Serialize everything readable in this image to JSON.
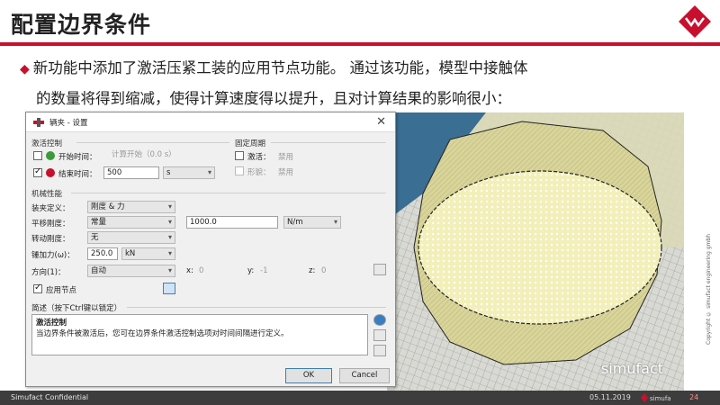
{
  "slide": {
    "title": "配置边界条件",
    "bullet_line1": "新功能中添加了激活压紧工装的应用节点功能。 通过该功能，模型中接触体",
    "bullet_line2": "的数量将得到缩减，使得计算速度得以提升，且对计算结果的影响很小：",
    "bullet_glyph": "◆"
  },
  "colors": {
    "accent": "#c8102e",
    "footer": "#3d3d3d",
    "mesh": "#f2efb8"
  },
  "dialog": {
    "title": "辆夹 - 设置",
    "close_glyph": "✕",
    "activation_group": "激活控制",
    "start_time_label": "开始时间：",
    "start_time_value": "计算开始（0.0 s）",
    "end_time_label": "结束时间：",
    "end_time_value": "500",
    "end_time_unit": "s",
    "fixed_period_group": "固定周期",
    "activate_label": "激活：",
    "activate_value": "禁用",
    "deform_label": "形貌：",
    "deform_value": "禁用",
    "mech_group": "机械性能",
    "clamp_def_label": "装夹定义：",
    "clamp_def_value": "刚度 & 力",
    "trans_stiff_label": "平移刚度：",
    "trans_stiff_value": "常量",
    "trans_stiff_number": "1000.0",
    "trans_stiff_unit": "N/m",
    "rot_stiff_label": "转动刚度：",
    "rot_stiff_value": "无",
    "clamp_force_label": "锤加力(ω)：",
    "clamp_force_value": "250.0",
    "clamp_force_unit": "kN",
    "direction_label": "方向(1)：",
    "direction_value": "自动",
    "x_label": "x:",
    "x_value": "0",
    "y_label": "y:",
    "y_value": "-1",
    "z_label": "z:",
    "z_value": "0",
    "apply_nodes_label": "应用节点",
    "desc_label": "简述（按下Ctrl键以锁定）",
    "desc_heading": "激活控制",
    "desc_text": "当边界条件被激活后，您可在边界条件激活控制选项对时间间隔进行定义。",
    "ok_label": "OK",
    "cancel_label": "Cancel"
  },
  "footer": {
    "left": "Simufact Confidential",
    "date": "05.11.2019",
    "page": "24",
    "brand": "simufact"
  },
  "sidebar_copyright": "Copyright © simufact engineering gmbh",
  "watermark": "simufact"
}
